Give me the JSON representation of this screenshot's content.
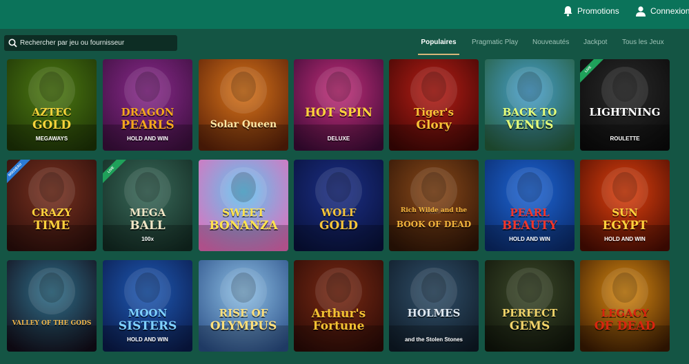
{
  "header": {
    "promotions_label": "Promotions",
    "login_label": "Connexion"
  },
  "search": {
    "placeholder": "Rechercher par jeu ou fournisseur"
  },
  "tabs": [
    {
      "label": "Populaires",
      "active": true
    },
    {
      "label": "Pragmatic Play",
      "active": false
    },
    {
      "label": "Nouveautés",
      "active": false
    },
    {
      "label": "Jackpot",
      "active": false
    },
    {
      "label": "Tous les Jeux",
      "active": false
    }
  ],
  "games": [
    {
      "t1": "AZTEC",
      "t2": "GOLD",
      "t3": "MEGAWAYS",
      "bg1": "#4e7a12",
      "bg2": "#1d3306",
      "text_color": "#f7d33b",
      "badge": ""
    },
    {
      "t1": "DRAGON",
      "t2": "PEARLS",
      "t3": "HOLD AND WIN",
      "bg1": "#8a2a8c",
      "bg2": "#3b0f3d",
      "text_color": "#f4a81c",
      "badge": ""
    },
    {
      "t1": "",
      "t2": "Solar Queen",
      "t3": "",
      "bg1": "#d9751a",
      "bg2": "#5a2008",
      "text_color": "#ffe8a6",
      "badge": ""
    },
    {
      "t1": "HOT SPIN",
      "t2": "",
      "t3": "DELUXE",
      "bg1": "#c42f7a",
      "bg2": "#3b0a36",
      "text_color": "#ffd23c",
      "badge": ""
    },
    {
      "t1": "Tiger's",
      "t2": "Glory",
      "t3": "",
      "bg1": "#b81e16",
      "bg2": "#3d0604",
      "text_color": "#f8c136",
      "badge": ""
    },
    {
      "t1": "BACK TO",
      "t2": "VENUS",
      "t3": "",
      "bg1": "#49a0cf",
      "bg2": "#255c3a",
      "text_color": "#e6ff7a",
      "badge": ""
    },
    {
      "t1": "LIGHTNING",
      "t2": "",
      "t3": "ROULETTE",
      "bg1": "#2a2a2a",
      "bg2": "#0a0a0a",
      "text_color": "#ffffff",
      "badge": "LIVE"
    },
    {
      "t1": "CRAZY",
      "t2": "TIME",
      "t3": "",
      "bg1": "#7a3220",
      "bg2": "#2a0d0a",
      "text_color": "#ffd23c",
      "badge": "NOUVEAU"
    },
    {
      "t1": "MEGA",
      "t2": "BALL",
      "t3": "100x",
      "bg1": "#3a6a5a",
      "bg2": "#122a22",
      "text_color": "#f0e6c6",
      "badge": "LIVE"
    },
    {
      "t1": "SWEET",
      "t2": "BONANZA",
      "t3": "",
      "bg1": "#5ec4f0",
      "bg2": "#e86bb8",
      "text_color": "#ffe34d",
      "badge": ""
    },
    {
      "t1": "WOLF",
      "t2": "GOLD",
      "t3": "",
      "bg1": "#1c2f86",
      "bg2": "#08113a",
      "text_color": "#f6c53a",
      "badge": ""
    },
    {
      "t1": "Rich Wilde and the",
      "t2": "BOOK OF DEAD",
      "t3": "",
      "bg1": "#8a4a1a",
      "bg2": "#2e1406",
      "text_color": "#f1b43d",
      "badge": ""
    },
    {
      "t1": "PEARL",
      "t2": "BEAUTY",
      "t3": "HOLD AND WIN",
      "bg1": "#1e66d6",
      "bg2": "#0a2a6a",
      "text_color": "#f2362a",
      "badge": ""
    },
    {
      "t1": "SUN",
      "t2": "EGYPT",
      "t3": "HOLD AND WIN",
      "bg1": "#e0410e",
      "bg2": "#4a0c02",
      "text_color": "#ffd23c",
      "badge": ""
    },
    {
      "t1": "",
      "t2": "VALLEY OF THE GODS",
      "t3": "",
      "bg1": "#2f6f8a",
      "bg2": "#120c18",
      "text_color": "#f2b64a",
      "badge": ""
    },
    {
      "t1": "MOON",
      "t2": "SISTERS",
      "t3": "HOLD AND WIN",
      "bg1": "#1f5bb6",
      "bg2": "#0a1a4a",
      "text_color": "#7fd1ff",
      "badge": ""
    },
    {
      "t1": "RISE OF",
      "t2": "OLYMPUS",
      "t3": "",
      "bg1": "#8fc1e6",
      "bg2": "#2a4e86",
      "text_color": "#ffe07a",
      "badge": ""
    },
    {
      "t1": "Arthur's",
      "t2": "Fortune",
      "t3": "",
      "bg1": "#7a2a14",
      "bg2": "#2a0a06",
      "text_color": "#f3c232",
      "badge": ""
    },
    {
      "t1": "HOLMES",
      "t2": "",
      "t3": "and the Stolen Stones",
      "bg1": "#31506a",
      "bg2": "#0e1a26",
      "text_color": "#dfe7ef",
      "badge": ""
    },
    {
      "t1": "PERFECT",
      "t2": "GEMS",
      "t3": "",
      "bg1": "#3d4a2a",
      "bg2": "#0f140a",
      "text_color": "#f2d46a",
      "badge": ""
    },
    {
      "t1": "LEGACY",
      "t2": "OF DEAD",
      "t3": "",
      "bg1": "#d98a12",
      "bg2": "#3a1a02",
      "text_color": "#d8250f",
      "badge": ""
    }
  ]
}
